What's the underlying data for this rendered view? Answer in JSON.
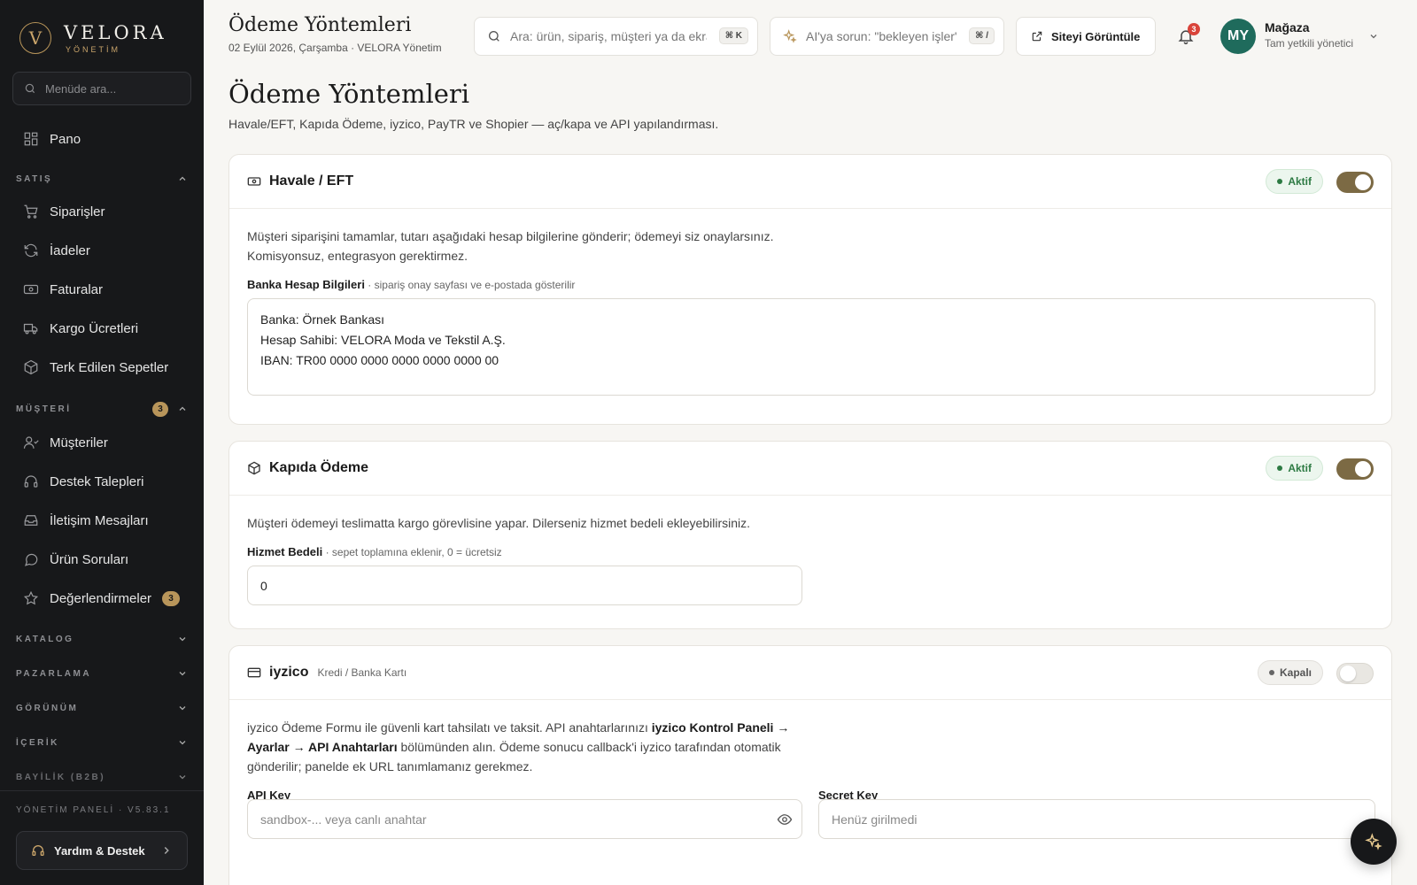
{
  "brand": {
    "name": "VELORA",
    "sub": "YÖNETİM",
    "mark": "V"
  },
  "sidebar": {
    "search_placeholder": "Menüde ara...",
    "items": {
      "dashboard": "Pano",
      "orders": "Siparişler",
      "returns": "İadeler",
      "invoices": "Faturalar",
      "shipping": "Kargo Ücretleri",
      "abandoned": "Terk Edilen Sepetler",
      "customers": "Müşteriler",
      "support": "Destek Talepleri",
      "messages": "İletişim Mesajları",
      "questions": "Ürün Soruları",
      "reviews": "Değerlendirmeler",
      "reviews_badge": "3"
    },
    "groups": {
      "sales": "SATIŞ",
      "customer": "MÜŞTERİ",
      "customer_badge": "3",
      "catalog": "KATALOG",
      "marketing": "PAZARLAMA",
      "appearance": "GÖRÜNÜM",
      "content": "İÇERİK",
      "dealer": "BAYİLİK (B2B)"
    },
    "version": "YÖNETİM PANELİ · V5.83.1",
    "help": "Yardım & Destek"
  },
  "header": {
    "title": "Ödeme Yöntemleri",
    "subtitle": "02 Eylül 2026, Çarşamba · VELORA Yönetim",
    "search_placeholder": "Ara: ürün, sipariş, müşteri ya da ekran",
    "search_kbd": "⌘ K",
    "ai_placeholder": "AI'ya sorun: \"bekleyen işler\"",
    "ai_kbd": "⌘ /",
    "view_site": "Siteyi Görüntüle",
    "notifications": "3",
    "user_initials": "MY",
    "user_name": "Mağaza",
    "user_role": "Tam yetkili yönetici"
  },
  "page": {
    "title": "Ödeme Yöntemleri",
    "subtitle": "Havale/EFT, Kapıda Ödeme, iyzico, PayTR ve Shopier — aç/kapa ve API yapılandırması."
  },
  "methods": {
    "eft": {
      "title": "Havale / EFT",
      "status": "Aktif",
      "desc": "Müşteri siparişini tamamlar, tutarı aşağıdaki hesap bilgilerine gönderir; ödemeyi siz onaylarsınız. Komisyonsuz, entegrasyon gerektirmez.",
      "field_label": "Banka Hesap Bilgileri",
      "field_hint": " · sipariş onay sayfası ve e-postada gösterilir",
      "field_value": "Banka: Örnek Bankası\nHesap Sahibi: VELORA Moda ve Tekstil A.Ş.\nIBAN: TR00 0000 0000 0000 0000 0000 00"
    },
    "cod": {
      "title": "Kapıda Ödeme",
      "status": "Aktif",
      "desc": "Müşteri ödemeyi teslimatta kargo görevlisine yapar. Dilerseniz hizmet bedeli ekleyebilirsiniz.",
      "field_label": "Hizmet Bedeli",
      "field_hint": " · sepet toplamına eklenir, 0 = ücretsiz",
      "field_value": "0"
    },
    "iyzico": {
      "title": "iyzico",
      "tag": "Kredi / Banka Kartı",
      "status": "Kapalı",
      "desc_1": "iyzico Ödeme Formu ile güvenli kart tahsilatı ve taksit. API anahtarlarınızı ",
      "desc_bold": "iyzico Kontrol Paneli → Ayarlar → API Anahtarları",
      "desc_2": " bölümünden alın. Ödeme sonucu callback'i iyzico tarafından otomatik gönderilir; panelde ek URL tanımlamanız gerekmez.",
      "api_key_label": "API Key",
      "api_key_placeholder": "sandbox-... veya canlı anahtar",
      "secret_key_label": "Secret Key",
      "secret_key_placeholder": "Henüz girilmedi"
    }
  }
}
